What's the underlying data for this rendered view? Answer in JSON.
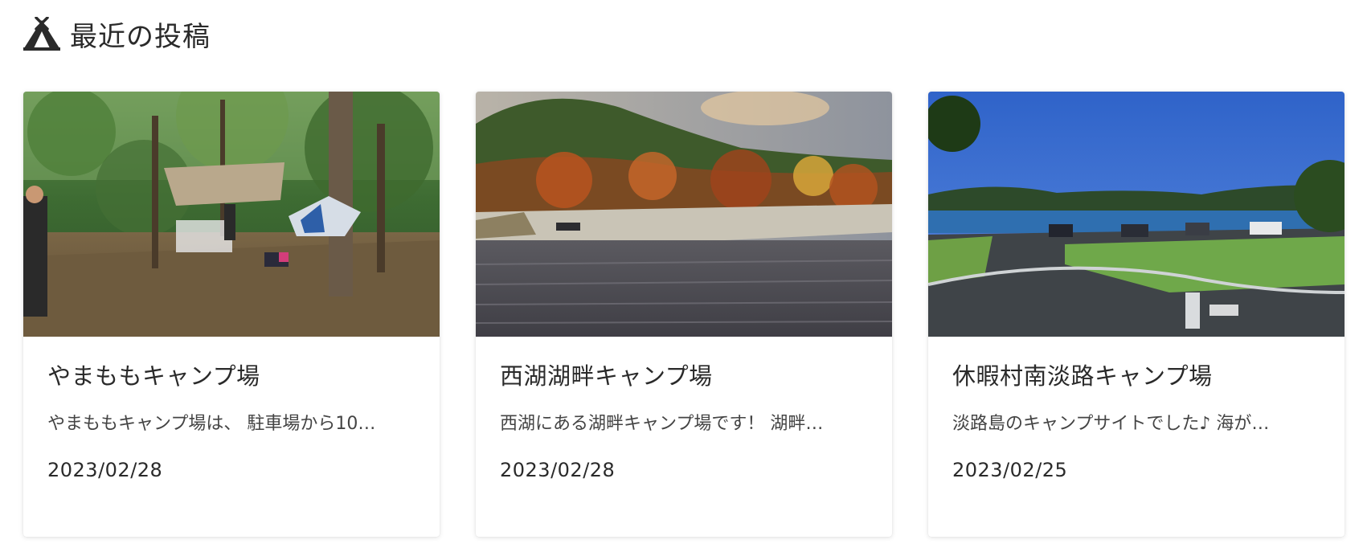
{
  "section": {
    "title": "最近の投稿",
    "icon": "tent-icon"
  },
  "posts": [
    {
      "title": "やまももキャンプ場",
      "excerpt": "やまももキャンプ場は、 駐車場から10…",
      "date": "2023/02/28",
      "image": "forest-campsite-photo"
    },
    {
      "title": "西湖湖畔キャンプ場",
      "excerpt": "西湖にある湖畔キャンプ場です！ 湖畔…",
      "date": "2023/02/28",
      "image": "lakeside-autumn-photo"
    },
    {
      "title": "休暇村南淡路キャンプ場",
      "excerpt": "淡路島のキャンプサイトでした♪ 海が…",
      "date": "2023/02/25",
      "image": "seaside-parking-photo"
    }
  ]
}
